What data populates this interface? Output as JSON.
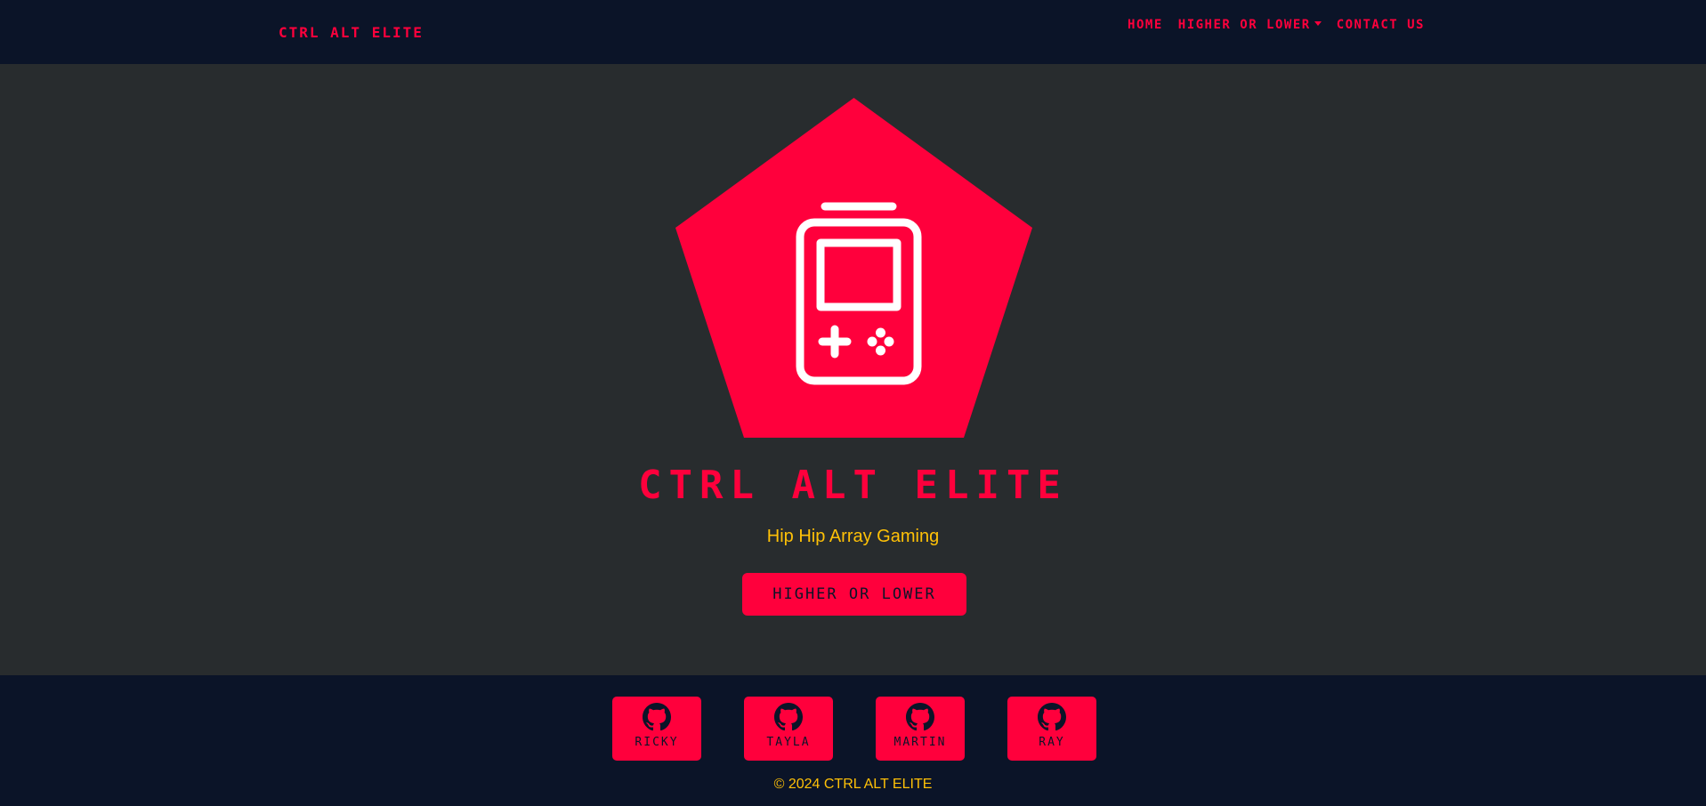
{
  "colors": {
    "accent": "#ff003c",
    "navbar_bg": "#0b1428",
    "hero_bg": "#282c2e",
    "subtitle": "#ffc107",
    "icon": "#ffffff"
  },
  "navbar": {
    "brand": "CTRL ALT ELITE",
    "links": [
      {
        "label": "HOME"
      },
      {
        "label": "HIGHER OR LOWER",
        "has_dropdown": true
      },
      {
        "label": "CONTACT US"
      }
    ]
  },
  "hero": {
    "logo_icon": "gameboy-icon",
    "title": "CTRL ALT ELITE",
    "subtitle": "Hip Hip Array Gaming",
    "button_label": "HIGHER OR LOWER"
  },
  "footer": {
    "members": [
      {
        "name": "RICKY",
        "icon": "github-icon"
      },
      {
        "name": "TAYLA",
        "icon": "github-icon"
      },
      {
        "name": "MARTIN",
        "icon": "github-icon"
      },
      {
        "name": "RAY",
        "icon": "github-icon"
      }
    ],
    "copyright": "© 2024 CTRL ALT ELITE"
  }
}
